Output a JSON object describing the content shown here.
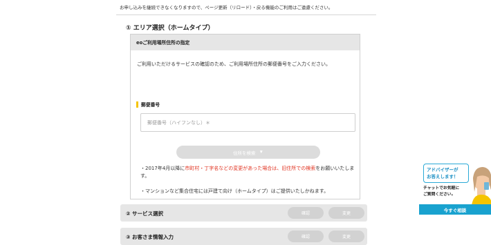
{
  "top_note": "お申し込みを継続できなくなりますので、ページ更新（リロード）・戻る機能のご利用はご遠慮ください。",
  "section1": {
    "title": "① エリア選択（ホームタイプ）",
    "card_header": "eoご利用場所住所の指定",
    "description": "ご利用いただけるサービスの確認のため、ご利用場所住所の郵便番号をご入力ください。",
    "zip_label": "郵便番号",
    "zip_placeholder": "郵便番号（ハイフンなし）＊",
    "search_button": "住所を検索",
    "search_arrow": "▼",
    "note1_prefix": "・2017年4月以降に",
    "note1_red": "市町村・丁字名などの変更があった場合は、旧住所での検索",
    "note1_suffix": "をお願いいたします。",
    "note2": "・マンションなど集合住宅には戸建て向け（ホームタイプ）はご提供いたしかねます。"
  },
  "steps": [
    {
      "label": "② サービス選択",
      "confirm": "確認",
      "change": "変更"
    },
    {
      "label": "③ お客さま情報入力",
      "confirm": "確認",
      "change": "変更"
    }
  ],
  "advisor": {
    "bubble_line1": "アドバイザーが",
    "bubble_line2": "お答えします！",
    "chat_line1": "チャットでお気軽に",
    "chat_line2": "ご質問ください。",
    "cta": "今すぐ相談"
  },
  "colors": {
    "accent_yellow": "#f5c400",
    "red_text": "#e0301e",
    "cta_blue": "#19a2cf"
  }
}
